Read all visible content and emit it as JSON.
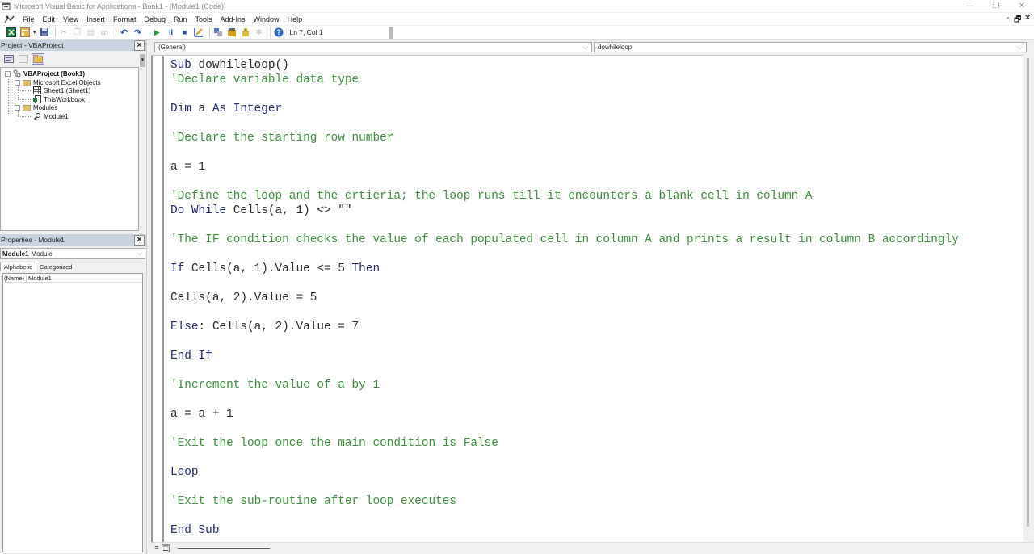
{
  "window": {
    "title": "Microsoft Visual Basic for Applications - Book1 - [Module1 (Code)]",
    "controls": {
      "minimize": "—",
      "restore": "❐",
      "close": "✕"
    },
    "mdi_controls": {
      "minimize": "-",
      "restore": "🗗",
      "close": "✕"
    }
  },
  "menubar": {
    "items": [
      {
        "label": "File",
        "accel": "F",
        "rest": "ile"
      },
      {
        "label": "Edit",
        "accel": "E",
        "rest": "dit"
      },
      {
        "label": "View",
        "accel": "V",
        "rest": "iew"
      },
      {
        "label": "Insert",
        "accel": "I",
        "rest": "nsert"
      },
      {
        "label": "Format",
        "accel": "o",
        "pre": "F",
        "rest": "rmat"
      },
      {
        "label": "Debug",
        "accel": "D",
        "rest": "ebug"
      },
      {
        "label": "Run",
        "accel": "R",
        "rest": "un"
      },
      {
        "label": "Tools",
        "accel": "T",
        "rest": "ools"
      },
      {
        "label": "Add-Ins",
        "accel": "A",
        "rest": "dd-Ins"
      },
      {
        "label": "Window",
        "accel": "W",
        "rest": "indow"
      },
      {
        "label": "Help",
        "accel": "H",
        "rest": "elp"
      }
    ]
  },
  "toolbar": {
    "icons": [
      "view-excel-icon",
      "insert-userform-icon",
      "save-icon",
      "cut-icon",
      "copy-icon",
      "paste-icon",
      "find-icon",
      "undo-icon",
      "redo-icon",
      "run-icon",
      "break-icon",
      "reset-icon",
      "design-mode-icon",
      "project-explorer-icon",
      "properties-window-icon",
      "object-browser-icon",
      "toolbox-icon",
      "help-icon"
    ],
    "cursor_position": "Ln 7, Col 1"
  },
  "project_panel": {
    "title": "Project - VBAProject",
    "close": "×",
    "tree": {
      "root": "VBAProject (Book1)",
      "folders": [
        {
          "label": "Microsoft Excel Objects",
          "items": [
            "Sheet1 (Sheet1)",
            "ThisWorkbook"
          ]
        },
        {
          "label": "Modules",
          "items": [
            "Module1"
          ]
        }
      ]
    }
  },
  "properties_panel": {
    "title": "Properties - Module1",
    "close": "×",
    "object_name": "Module1",
    "object_type": "Module",
    "tabs": [
      "Alphabetic",
      "Categorized"
    ],
    "rows": [
      {
        "key": "(Name)",
        "value": "Module1"
      }
    ]
  },
  "code_window": {
    "object_combo": "(General)",
    "procedure_combo": "dowhileloop",
    "lines": [
      [
        {
          "t": "kw",
          "s": "Sub "
        },
        {
          "t": "tx",
          "s": "dowhileloop()"
        }
      ],
      [
        {
          "t": "cm",
          "s": "'Declare variable data type"
        }
      ],
      [],
      [
        {
          "t": "kw",
          "s": "Dim "
        },
        {
          "t": "tx",
          "s": "a "
        },
        {
          "t": "kw",
          "s": "As Integer"
        }
      ],
      [],
      [
        {
          "t": "cm",
          "s": "'Declare the starting row number"
        }
      ],
      [],
      [
        {
          "t": "tx",
          "s": "a = 1"
        }
      ],
      [],
      [
        {
          "t": "cm",
          "s": "'Define the loop and the crtieria; the loop runs till it encounters a blank cell in column A"
        }
      ],
      [
        {
          "t": "kw",
          "s": "Do While "
        },
        {
          "t": "tx",
          "s": "Cells(a, 1) <> \"\""
        }
      ],
      [],
      [
        {
          "t": "cm",
          "s": "'The IF condition checks the value of each populated cell in column A and prints a result in column B accordingly"
        }
      ],
      [],
      [
        {
          "t": "kw",
          "s": "If "
        },
        {
          "t": "tx",
          "s": "Cells(a, 1).Value <= 5 "
        },
        {
          "t": "kw",
          "s": "Then"
        }
      ],
      [],
      [
        {
          "t": "tx",
          "s": "Cells(a, 2).Value = 5"
        }
      ],
      [],
      [
        {
          "t": "kw",
          "s": "Else"
        },
        {
          "t": "tx",
          "s": ": Cells(a, 2).Value = 7"
        }
      ],
      [],
      [
        {
          "t": "kw",
          "s": "End If"
        }
      ],
      [],
      [
        {
          "t": "cm",
          "s": "'Increment the value of a by 1"
        }
      ],
      [],
      [
        {
          "t": "tx",
          "s": "a = a + 1"
        }
      ],
      [],
      [
        {
          "t": "cm",
          "s": "'Exit the loop once the main condition is False"
        }
      ],
      [],
      [
        {
          "t": "kw",
          "s": "Loop"
        }
      ],
      [],
      [
        {
          "t": "cm",
          "s": "'Exit the sub-routine after loop executes"
        }
      ],
      [],
      [
        {
          "t": "kw",
          "s": "End Sub"
        }
      ]
    ],
    "view_buttons": {
      "procedure_view": "≡",
      "full_module_view": "☰"
    }
  }
}
